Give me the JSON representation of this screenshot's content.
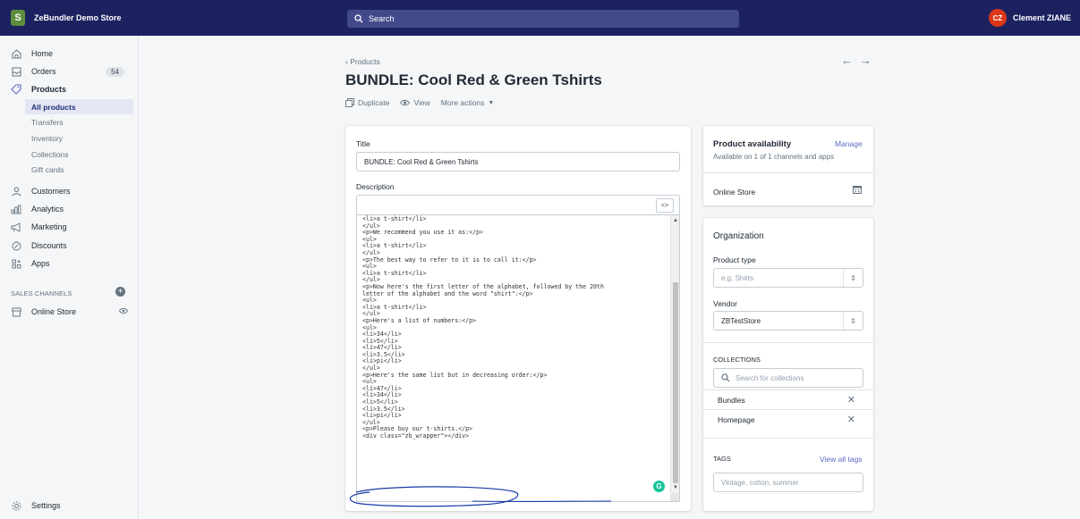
{
  "topbar": {
    "store_logo": "S",
    "store_name": "ZeBundler Demo Store",
    "search_placeholder": "Search",
    "user_initials": "CZ",
    "user_name": "Clement ZIANE"
  },
  "sidebar": {
    "home": "Home",
    "orders": "Orders",
    "orders_badge": "54",
    "products": "Products",
    "sub_items": [
      "All products",
      "Transfers",
      "Inventory",
      "Collections",
      "Gift cards"
    ],
    "customers": "Customers",
    "analytics": "Analytics",
    "marketing": "Marketing",
    "discounts": "Discounts",
    "apps": "Apps",
    "sales_channels_label": "SALES CHANNELS",
    "online_store": "Online Store",
    "settings": "Settings"
  },
  "header": {
    "breadcrumb": "Products",
    "title": "BUNDLE: Cool Red & Green Tshirts",
    "duplicate": "Duplicate",
    "view": "View",
    "more_actions": "More actions"
  },
  "main": {
    "title_label": "Title",
    "title_value": "BUNDLE: Cool Red & Green Tshirts",
    "description_label": "Description",
    "code_toggle": "<>",
    "code": "<li>a t-shirt</li>\n</ul>\n<p>We recommend you use it as:</p>\n<ul>\n<li>a t-shirt</li>\n</ul>\n<p>The best way to refer to it is to call it:</p>\n<ul>\n<li>a t-shirt</li>\n</ul>\n<p>Now here's the first letter of the alphabet, followed by the 20th\nletter of the alphabet and the word \"shirt\":</p>\n<ul>\n<li>a t-shirt</li>\n</ul>\n<p>Here's a list of numbers:</p>\n<ul>\n<li>34</li>\n<li>5</li>\n<li>47</li>\n<li>3.5</li>\n<li>pi</li>\n</ul>\n<p>Here's the same list but in decreasing order:</p>\n<ul>\n<li>47</li>\n<li>34</li>\n<li>5</li>\n<li>3.5</li>\n<li>pi</li>\n</ul>\n<p>Please buy our t-shirts.</p>\n<div class=\"zb_wrapper\"></div>",
    "grammarly_badge": "G"
  },
  "availability": {
    "title": "Product availability",
    "manage": "Manage",
    "subtitle": "Available on 1 of 1 channels and apps",
    "channel": "Online Store"
  },
  "organization": {
    "title": "Organization",
    "product_type_label": "Product type",
    "product_type_placeholder": "e.g. Shirts",
    "vendor_label": "Vendor",
    "vendor_value": "ZBTestStore",
    "collections_label": "COLLECTIONS",
    "collections_search_placeholder": "Search for collections",
    "collections": [
      "Bundles",
      "Homepage"
    ],
    "tags_label": "TAGS",
    "view_all_tags": "View all tags",
    "tags_placeholder": "Vintage, cotton, summer"
  },
  "colors": {
    "topbar": "#1c2260",
    "accent": "#5c6ac4",
    "annotation": "#1a3aa8"
  }
}
